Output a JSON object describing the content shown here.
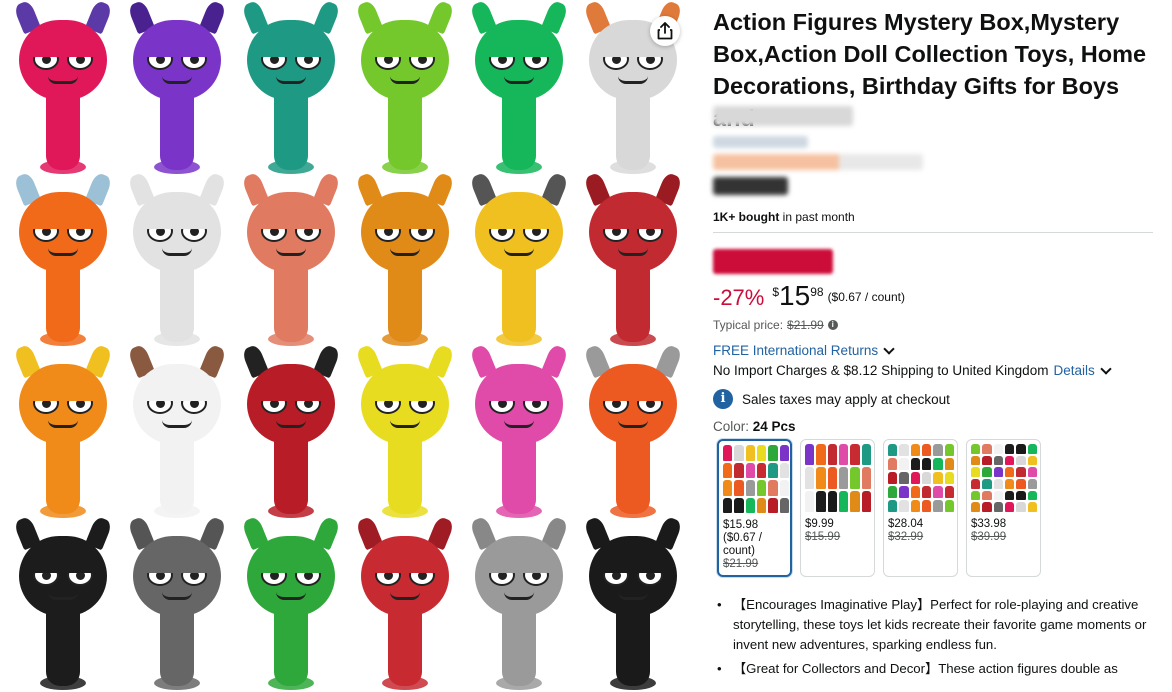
{
  "product": {
    "title": "Action Figures Mystery Box,Mystery Box,Action Doll Collection Toys, Home Decorations, Birthday Gifts for Boys and",
    "bought_count": "1K+ bought",
    "bought_suffix": "in past month"
  },
  "price": {
    "discount": "-27%",
    "currency": "$",
    "whole": "15",
    "fraction": "98",
    "unit_price": "($0.67 / count)",
    "typical_label": "Typical price:",
    "typical_value": "$21.99"
  },
  "delivery": {
    "returns": "FREE International Returns",
    "shipping": "No Import Charges & $8.12 Shipping to United Kingdom",
    "details_link": "Details",
    "tax_note": "Sales taxes may apply at checkout"
  },
  "color": {
    "label": "Color:",
    "selected": "24 Pcs",
    "options": [
      {
        "price": "$15.98",
        "unit": "($0.67 / count)",
        "old": "$21.99"
      },
      {
        "price": "$9.99",
        "unit": "",
        "old": "$15.99"
      },
      {
        "price": "$28.04",
        "unit": "",
        "old": "$32.99"
      },
      {
        "price": "$33.98",
        "unit": "",
        "old": "$39.99"
      }
    ]
  },
  "bullets": [
    "【Encourages Imaginative Play】Perfect for role-playing and creative storytelling, these toys let kids recreate their favorite game moments or invent new adventures, sparking endless fun.",
    "【Great for Collectors and Decor】These action figures double as"
  ],
  "colors": {
    "link": "#2162a1",
    "deal": "#cc0c39",
    "text": "#0f1111",
    "muted": "#565959"
  },
  "icons": {
    "share": "share-icon",
    "info": "info-icon",
    "chevron": "chevron-down-icon"
  },
  "figures": [
    {
      "color": "#e0185a",
      "ear": "#5b3aa8"
    },
    {
      "color": "#7a35c8",
      "ear": "#4a228f"
    },
    {
      "color": "#1e9a84",
      "ear": "#1e9a84"
    },
    {
      "color": "#74c82c",
      "ear": "#74c82c"
    },
    {
      "color": "#16b65a",
      "ear": "#16b65a"
    },
    {
      "color": "#d8d8d8",
      "ear": "#e07a3a"
    },
    {
      "color": "#f06a1a",
      "ear": "#9cc0d6"
    },
    {
      "color": "#e2e2e2",
      "ear": "#e2e2e2"
    },
    {
      "color": "#e07a60",
      "ear": "#e07a60"
    },
    {
      "color": "#e08a18",
      "ear": "#e08a18"
    },
    {
      "color": "#f0c020",
      "ear": "#555555"
    },
    {
      "color": "#c02a30",
      "ear": "#9a1c22"
    },
    {
      "color": "#f08a18",
      "ear": "#f0c020"
    },
    {
      "color": "#f2f2f2",
      "ear": "#8a5a40"
    },
    {
      "color": "#b81c26",
      "ear": "#222222"
    },
    {
      "color": "#e8dc20",
      "ear": "#e8dc20"
    },
    {
      "color": "#e04aa8",
      "ear": "#e04aa8"
    },
    {
      "color": "#ec5a22",
      "ear": "#9a9a9a"
    },
    {
      "color": "#1c1c1c",
      "ear": "#1c1c1c"
    },
    {
      "color": "#666666",
      "ear": "#555555"
    },
    {
      "color": "#2ea83a",
      "ear": "#2ea83a"
    },
    {
      "color": "#c82a32",
      "ear": "#a01c24"
    },
    {
      "color": "#9a9a9a",
      "ear": "#888888"
    },
    {
      "color": "#1a1a1a",
      "ear": "#1a1a1a"
    }
  ]
}
